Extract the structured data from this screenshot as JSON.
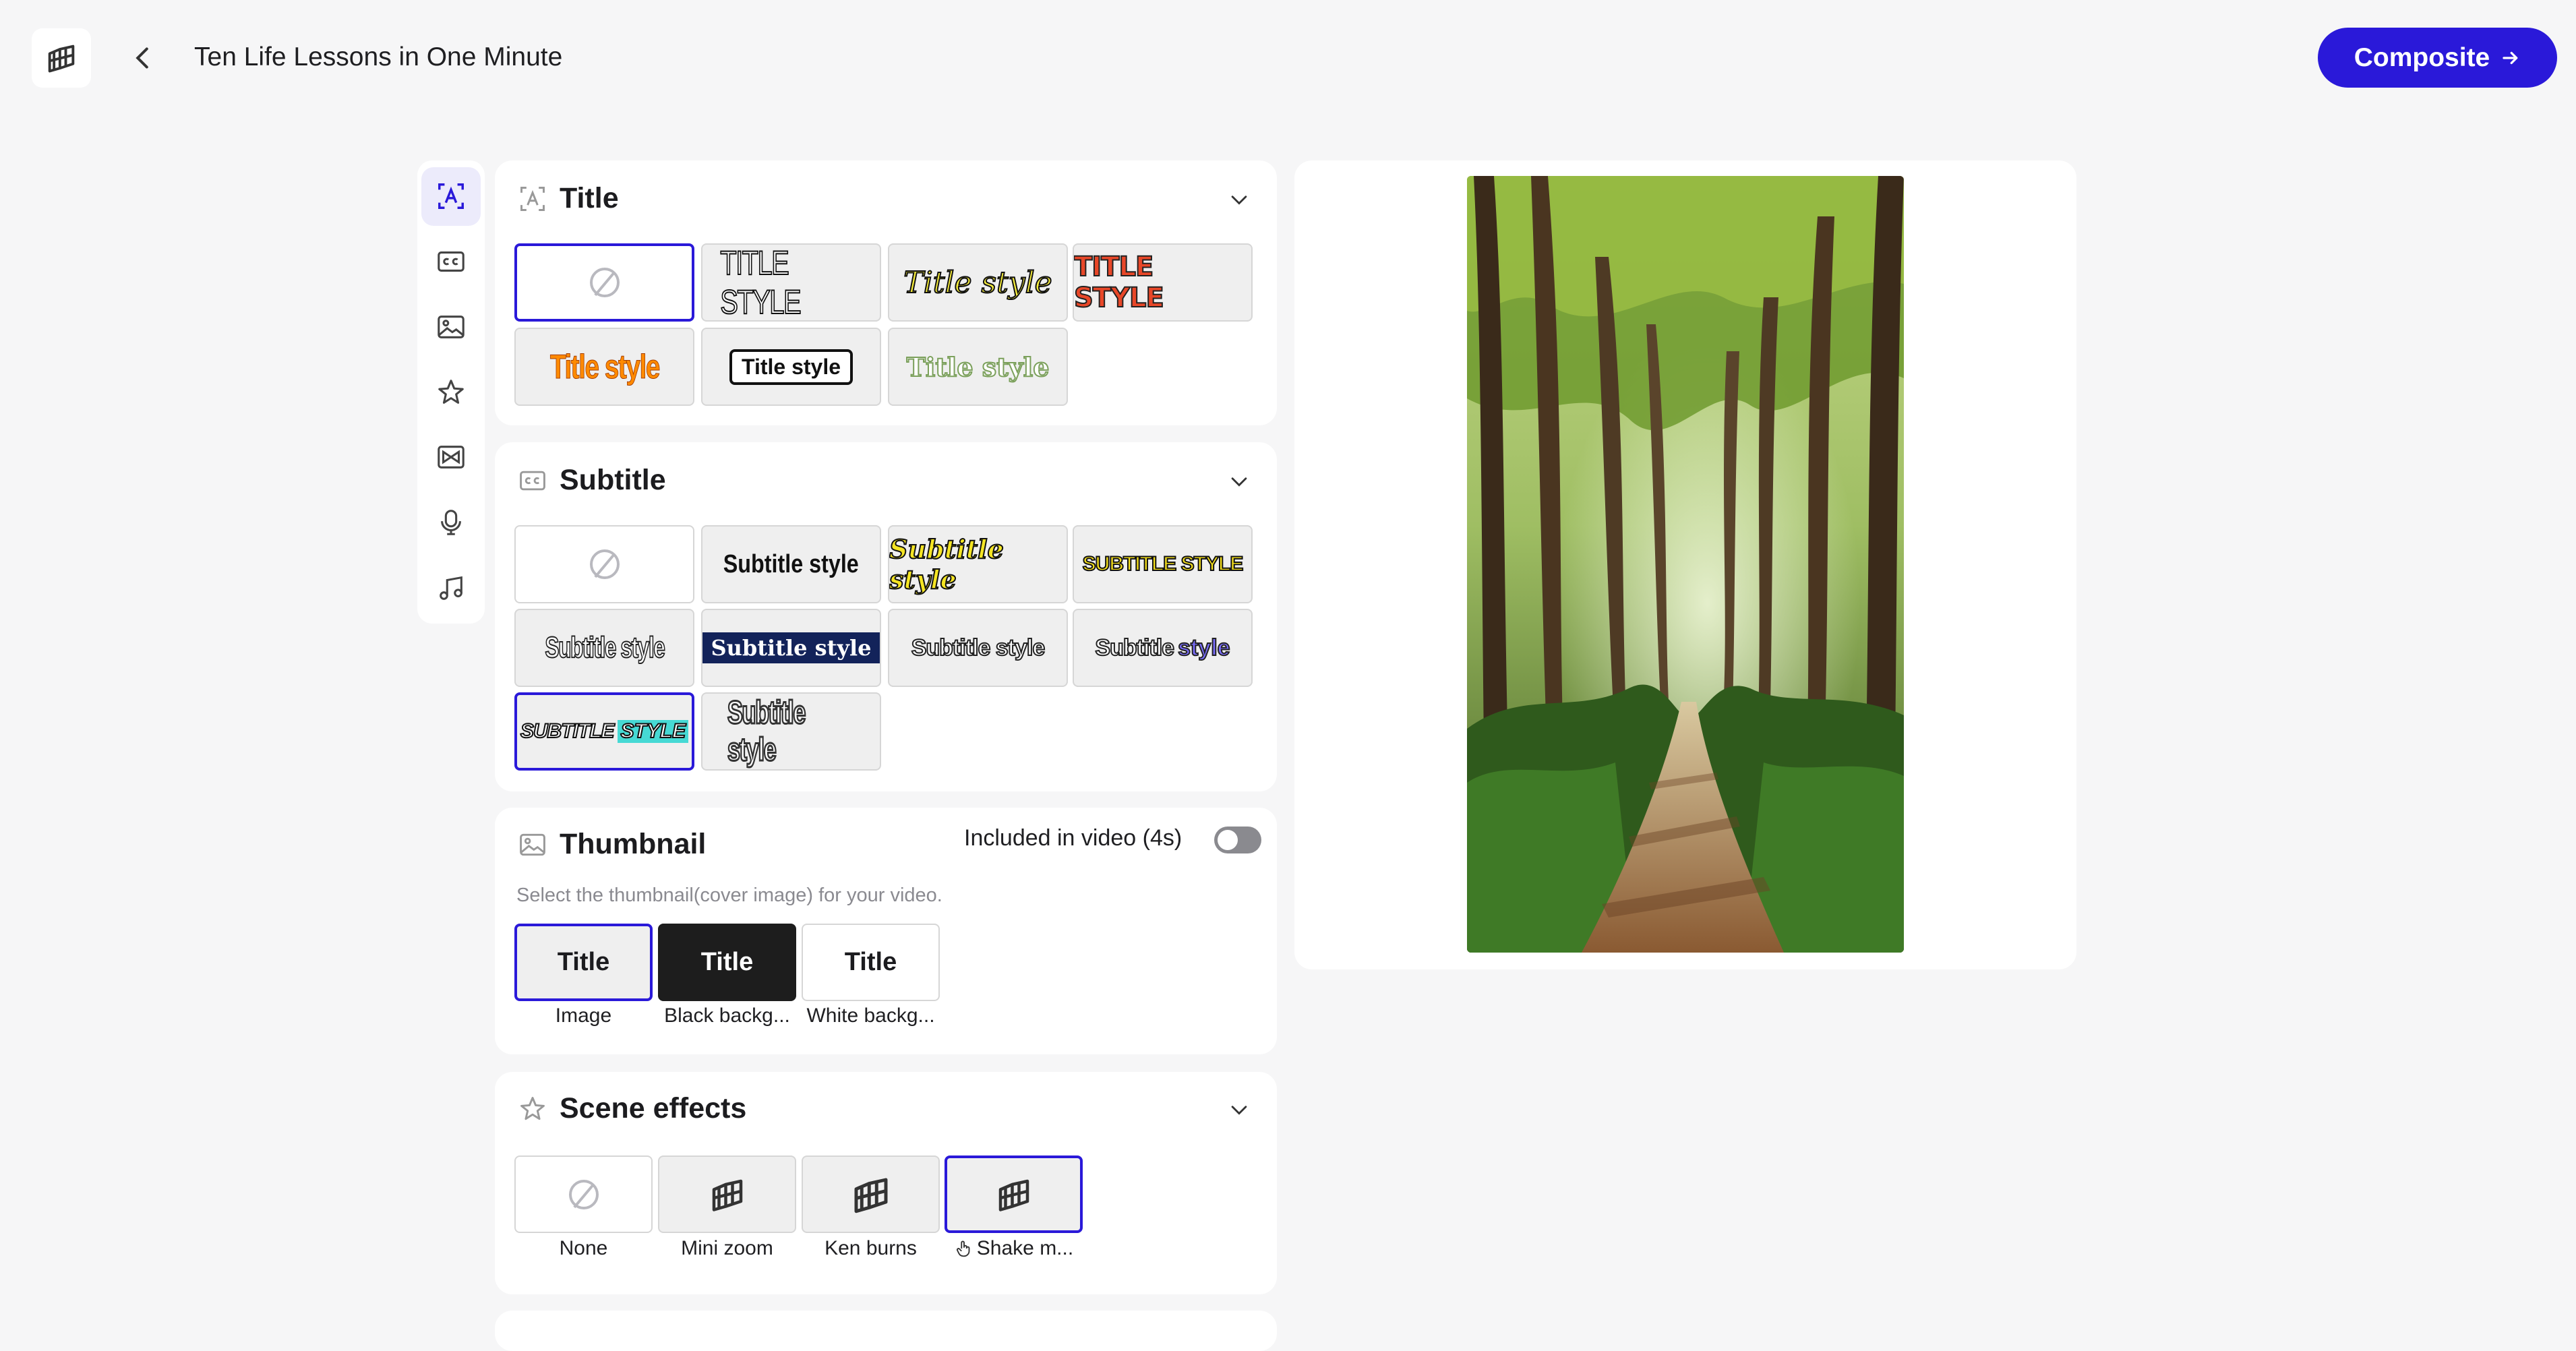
{
  "header": {
    "project_title": "Ten Life Lessons in One Minute",
    "composite_label": "Composite",
    "composite_arrow": "→",
    "back_glyph": "‹"
  },
  "sidenav": {
    "items": [
      "title-icon",
      "subtitle-icon",
      "thumbnail-icon",
      "scene-effects-icon",
      "transition-icon",
      "voice-icon",
      "music-icon"
    ]
  },
  "title_panel": {
    "heading": "Title",
    "styles": [
      "TITLE STYLE",
      "Title style",
      "TITLE STYLE",
      "Title style",
      "Title style",
      "Title style"
    ]
  },
  "subtitle_panel": {
    "heading": "Subtitle",
    "styles": [
      "Subtitle style",
      "Subtitle style",
      "SUBTITLE STYLE",
      "Subtitle style",
      "Subtitle style",
      "Subtitle style",
      "Subtitle",
      "style",
      "SUBTITLE",
      "STYLE",
      "Subtitle style"
    ]
  },
  "thumbnail_panel": {
    "heading": "Thumbnail",
    "included_label": "Included in video (4s)",
    "included_on": false,
    "description": "Select the thumbnail(cover image) for your video.",
    "options": [
      {
        "text": "Title",
        "label": "Image"
      },
      {
        "text": "Title",
        "label": "Black backg..."
      },
      {
        "text": "Title",
        "label": "White backg..."
      }
    ]
  },
  "scene_effects_panel": {
    "heading": "Scene effects",
    "options": [
      {
        "label": "None"
      },
      {
        "label": "Mini zoom"
      },
      {
        "label": "Ken burns"
      },
      {
        "label": "Shake m..."
      }
    ]
  },
  "preview": {
    "description_icon": "forest-path-image"
  },
  "colors": {
    "accent": "#2a19d9",
    "background": "#f6f6f7"
  }
}
